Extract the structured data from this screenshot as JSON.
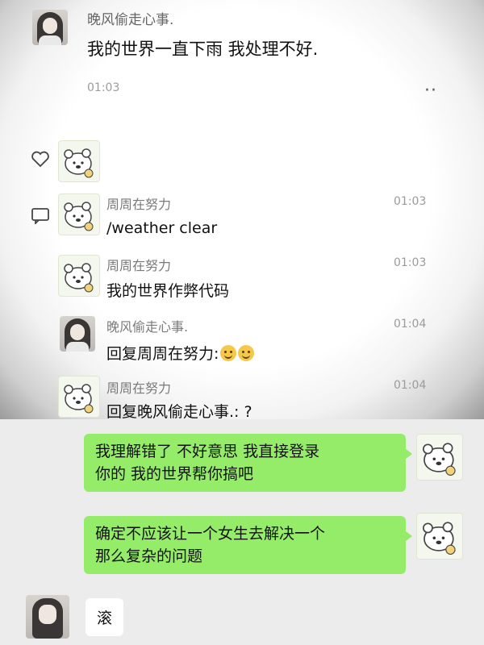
{
  "screenshot": {
    "messages": [
      {
        "name": "晚风偷走心事.",
        "text": "我的世界一直下雨 我处理不好.",
        "time": "01:03"
      },
      {
        "name": "周周在努力",
        "text": "/weather clear",
        "time": "01:03"
      },
      {
        "name": "周周在努力",
        "text": "我的世界作弊代码",
        "time": "01:03"
      },
      {
        "name": "晚风偷走心事.",
        "text": "回复周周在努力:",
        "time": "01:04"
      },
      {
        "name": "周周在努力",
        "text": "回复晚风偷走心事.: ?",
        "time": "01:04"
      }
    ],
    "more_dots": "··"
  },
  "chat": {
    "sent": [
      {
        "line1": "我理解错了 不好意思 我直接登录",
        "line2": "你的 我的世界帮你搞吧"
      },
      {
        "line1": "确定不应该让一个女生去解决一个",
        "line2": "那么复杂的问题"
      }
    ],
    "received": [
      {
        "text": "滚"
      }
    ]
  },
  "colors": {
    "sent_bubble": "#95ec69",
    "received_bubble": "#ffffff",
    "background": "#ececec"
  },
  "icons": [
    "girl-avatar",
    "bear-avatar",
    "heart-icon",
    "comment-icon",
    "emoji-smile-icon"
  ]
}
